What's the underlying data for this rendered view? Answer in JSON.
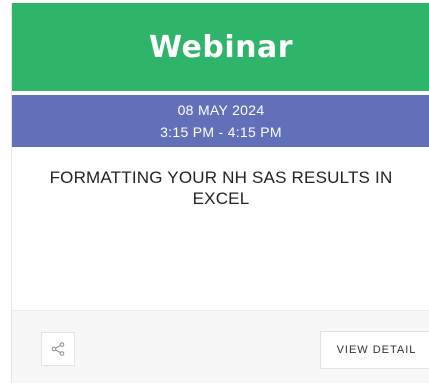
{
  "card": {
    "category": "Webinar",
    "date": "08 MAY 2024",
    "time": "3:15 PM - 4:15 PM",
    "title": "FORMATTING YOUR NH SAS RESULTS IN EXCEL",
    "share_icon": "share-icon",
    "detail_label": "VIEW DETAIL"
  },
  "colors": {
    "header_bg": "#2fb56a",
    "date_band_bg": "#6170b8"
  }
}
